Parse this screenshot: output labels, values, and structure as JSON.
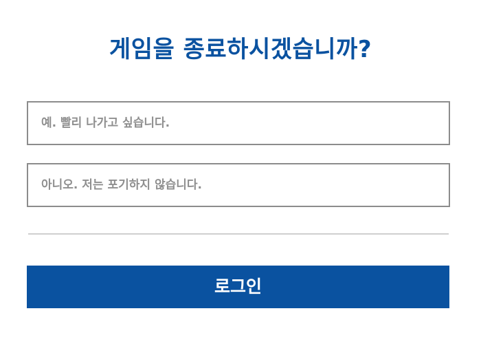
{
  "dialog": {
    "title": "게임을 종료하시겠습니까?",
    "options": [
      {
        "label": "예. 빨리 나가고 싶습니다."
      },
      {
        "label": "아니오. 저는 포기하지 않습니다."
      }
    ],
    "login_button_label": "로그인"
  },
  "colors": {
    "accent": "#0a52a0",
    "option_border": "#8c8c8c",
    "option_text": "#8f8f8f",
    "divider": "#cfcfcf",
    "background": "#ffffff"
  }
}
